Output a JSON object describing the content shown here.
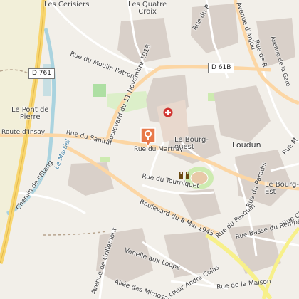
{
  "map": {
    "places": {
      "les_cerisiers": "Les Cerisiers",
      "les_quatre_croix": "Les Quatre\nCroix",
      "le_pont_de_pierre": "Le Pont de\nPierre",
      "le_bourg_ouest": "Le Bourg-\nouest",
      "loudun": "Loudun",
      "le_bourg_est": "Le Bourg-\nEst"
    },
    "road_shields": {
      "d761": "D 761",
      "d61b": "D 61B"
    },
    "streets": {
      "moulin_patron": "Rue du Moulin Patron",
      "boulevard_11_novembre": "Boulevard du 11 Novembre 1918",
      "route_insay": "Route d'Insay",
      "rue_sanitat": "Rue du Sanitat",
      "rue_martray": "Rue du Martray",
      "rue_tourniquet": "Rue du Tourniquet",
      "boulevard_8_mai": "Boulevard du 8 Mai 1945",
      "chemin_etang": "Chemin de l'Etang",
      "avenue_anjou": "Avenue d'Anjou",
      "avenue_de_la_gare": "Avenue de la Gare",
      "rue_du_pasquin": "Rue du Pasquin",
      "rue_du_paradis": "Rue du Paradis",
      "rue_basse_rempart": "Rue Basse du Rempart",
      "venelle_aux_loups": "Venelle aux Loups",
      "avenue_grillemont": "Avenue de Grillemont",
      "allee_mimosas": "Allée des Mimosas",
      "rue_maison": "Rue de la Maison",
      "cteur_andre_colas": "cteur André Colas",
      "rue_m_edge": "Rue M",
      "rue_ch_edge": "Rue Ch",
      "rue_du_p": "Rue du P",
      "rue_de_r": "Rue de R",
      "river_martiel": "Le Martiel"
    },
    "colors": {
      "background": "#f2efe9",
      "fields": "#f2efd9",
      "buildings": "#d9d0c9",
      "park": "#cdebb0",
      "water": "#aad3df",
      "primary_road": "#fcd6a4",
      "trunk_road": "#f8d56e",
      "marker": "#e8794a",
      "hospital": "#d0332f"
    },
    "icons": [
      "location-pin-icon",
      "hospital-cross-icon",
      "castle-icon"
    ]
  }
}
